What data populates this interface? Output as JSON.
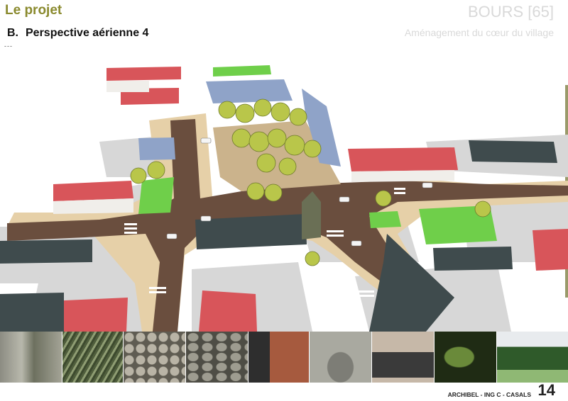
{
  "header": {
    "section": "Le projet",
    "subtitle_letter": "B.",
    "subtitle_text": "Perspective aérienne 4",
    "dots": "---",
    "project_title": "BOURS [65]",
    "project_subtitle": "Aménagement du cœur du village"
  },
  "footer": {
    "credit": "ARCHIBEL - ING C - CASALS",
    "page_number": "14"
  },
  "colors": {
    "header_accent": "#8a8a2e",
    "project_title": "#d9d9d9",
    "road": "#6b4f3f",
    "sidewalk": "#e5cfa6",
    "grass": "#6fcf4a",
    "red_roof": "#d8555a",
    "slate_roof": "#3e4a4c",
    "blue_roof": "#8fa3c8",
    "tree": "#b7c545",
    "shadow": "#d5d5d5"
  },
  "photos": [
    "gutter-photo",
    "grass-photo",
    "cobblestone-photo",
    "stone-wall-photo",
    "brick-wall-photo",
    "gothic-window-photo",
    "door-frame-photo",
    "leaves-photo",
    "garden-photo"
  ]
}
